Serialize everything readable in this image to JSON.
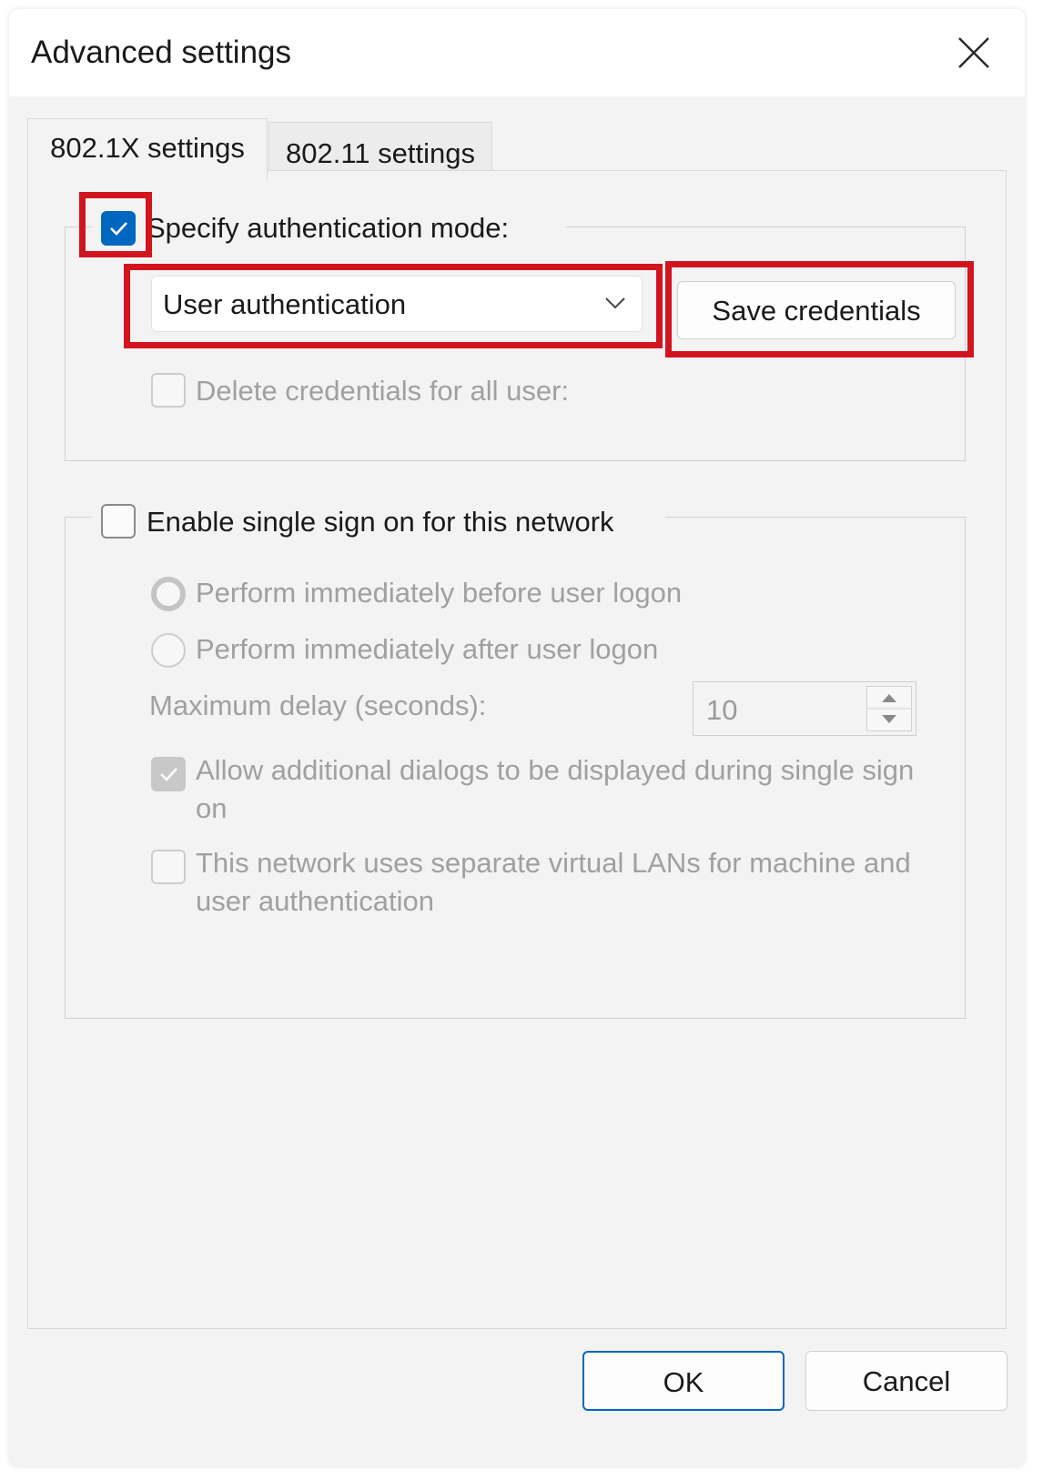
{
  "window": {
    "title": "Advanced settings"
  },
  "tabs": [
    {
      "label": "802.1X settings",
      "active": true
    },
    {
      "label": "802.11 settings",
      "active": false
    }
  ],
  "auth": {
    "specify_label": "Specify authentication mode:",
    "specify_checked": true,
    "mode_value": "User authentication",
    "save_credentials_label": "Save credentials",
    "delete_credentials_label": "Delete credentials for all user:",
    "delete_credentials_checked": false
  },
  "sso": {
    "enable_label": "Enable single sign on for this network",
    "enable_checked": false,
    "before_logon_label": "Perform immediately before user logon",
    "after_logon_label": "Perform immediately after user logon",
    "max_delay_label": "Maximum delay (seconds):",
    "max_delay_value": "10",
    "allow_dialogs_label": "Allow additional dialogs to be displayed during single sign on",
    "allow_dialogs_checked": true,
    "vlan_label": "This network uses separate virtual LANs for machine and user authentication",
    "vlan_checked": false
  },
  "footer": {
    "ok_label": "OK",
    "cancel_label": "Cancel"
  },
  "colors": {
    "accent": "#0067c0",
    "highlight": "#d2141f"
  }
}
